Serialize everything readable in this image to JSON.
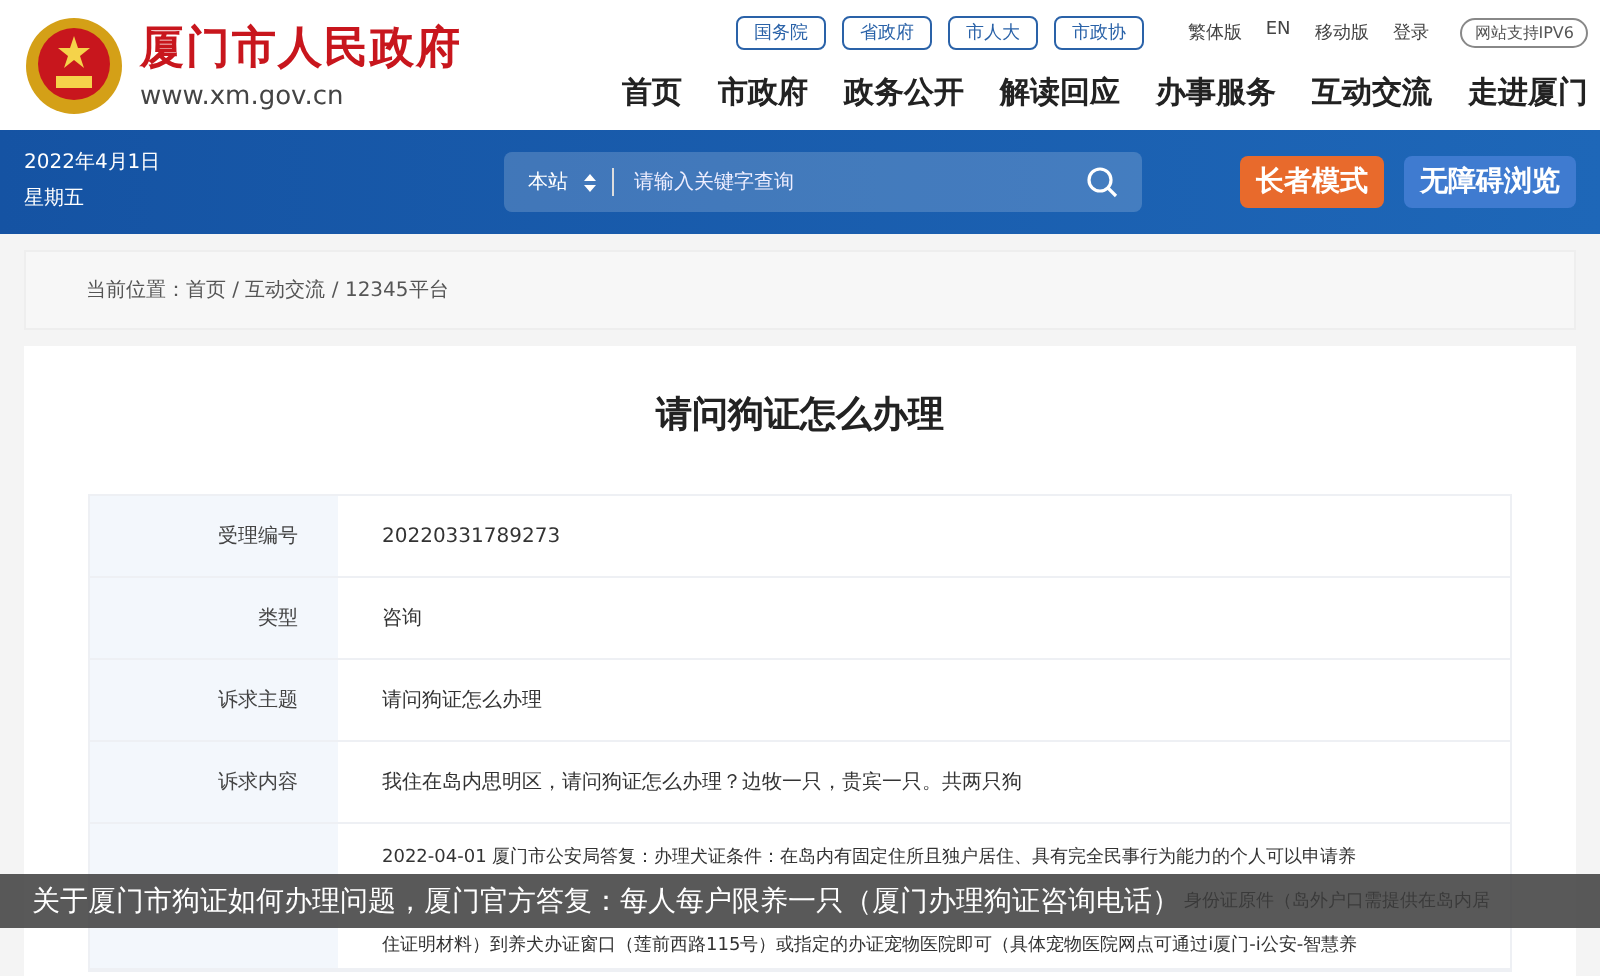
{
  "header": {
    "site_name": "厦门市人民政府",
    "site_url": "www.xm.gov.cn",
    "top_links": [
      "国务院",
      "省政府",
      "市人大",
      "市政协"
    ],
    "util_links": [
      "繁体版",
      "EN",
      "移动版",
      "登录"
    ],
    "ipv6_badge": "网站支持IPV6",
    "nav": [
      "首页",
      "市政府",
      "政务公开",
      "解读回应",
      "办事服务",
      "互动交流",
      "走进厦门"
    ]
  },
  "banner": {
    "date": "2022年4月1日",
    "weekday": "星期五",
    "search": {
      "scope": "本站",
      "placeholder": "请输入关键字查询"
    },
    "buttons": [
      {
        "label": "长者模式",
        "kind": "elder"
      },
      {
        "label": "无障碍浏览",
        "kind": "access"
      }
    ]
  },
  "breadcrumb": "当前位置：首页 / 互动交流 / 12345平台",
  "article": {
    "title": "请问狗证怎么办理",
    "rows": [
      {
        "label": "受理编号",
        "value": "20220331789273"
      },
      {
        "label": "类型",
        "value": "咨询"
      },
      {
        "label": "诉求主题",
        "value": "请问狗证怎么办理"
      },
      {
        "label": "诉求内容",
        "value": "我住在岛内思明区，请问狗证怎么办理？边牧一只，贵宾一只。共两只狗"
      }
    ],
    "answer_lines": [
      "2022-04-01 厦门市公安局答复：办理犬证条件：在岛内有固定住所且独户居住、具有完全民事行为能力的个人可以申请养",
      "身份证原件（岛外户口需提供在岛内居",
      "住证明材料）到养犬办证窗口（莲前西路115号）或指定的办证宠物医院即可（具体宠物医院网点可通过i厦门-i公安-智慧养"
    ]
  },
  "caption": "关于厦门市狗证如何办理问题，厦门官方答复：每人每户限养一只（厦门办理狗证咨询电话）"
}
